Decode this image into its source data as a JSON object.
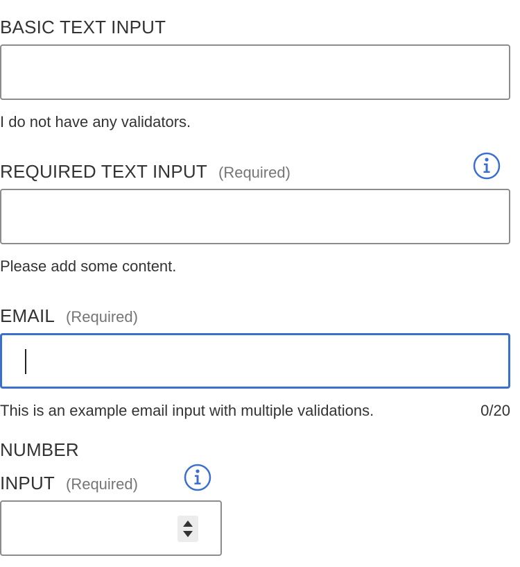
{
  "basic": {
    "label": "BASIC TEXT INPUT",
    "value": "",
    "help": "I do not have any validators."
  },
  "required_text": {
    "label": "REQUIRED TEXT INPUT",
    "required": "(Required)",
    "value": "",
    "help": "Please add some content.",
    "icon": "info-icon"
  },
  "email": {
    "label": "EMAIL",
    "required": "(Required)",
    "value": "",
    "help": "This is an example email input with multiple validations.",
    "counter": "0/20",
    "focused": true
  },
  "number": {
    "label_line1": "NUMBER",
    "label_line2": "INPUT",
    "required": "(Required)",
    "value": "",
    "icon": "info-icon"
  },
  "colors": {
    "focus_border": "#3a6fd0",
    "info_icon": "#3a6fd0",
    "border": "#8c8c8c",
    "text": "#333333",
    "secondary_text": "#757575"
  }
}
